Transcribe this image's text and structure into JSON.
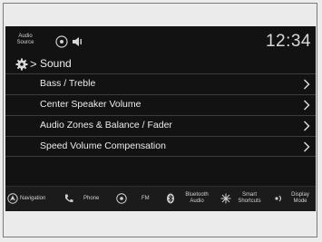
{
  "status": {
    "audio_source_line1": "Audio",
    "audio_source_line2": "Source",
    "clock": "12:34"
  },
  "header": {
    "separator": ">",
    "title": "Sound"
  },
  "menu": {
    "items": [
      {
        "label": "Bass / Treble"
      },
      {
        "label": "Center Speaker Volume"
      },
      {
        "label": "Audio Zones & Balance / Fader"
      },
      {
        "label": "Speed Volume Compensation"
      }
    ]
  },
  "shortcuts": {
    "navigation": "Navigation",
    "phone": "Phone",
    "fm": "FM",
    "bluetooth_line1": "Bluetooth",
    "bluetooth_line2": "Audio",
    "smart_line1": "Smart",
    "smart_line2": "Shortcuts",
    "display_line1": "Display",
    "display_line2": "Mode"
  },
  "icons": {
    "status": [
      "audio-source-icon",
      "volume-icon"
    ],
    "header": "gear-icon",
    "row": "chevron-right-icon",
    "shortcuts": [
      "navigation-icon",
      "phone-icon",
      "radio-icon",
      "bluetooth-icon",
      "smart-shortcuts-icon",
      "display-mode-icon"
    ]
  },
  "colors": {
    "screen_bg": "#121212",
    "text": "#ececec",
    "divider": "#3c3c3c"
  }
}
